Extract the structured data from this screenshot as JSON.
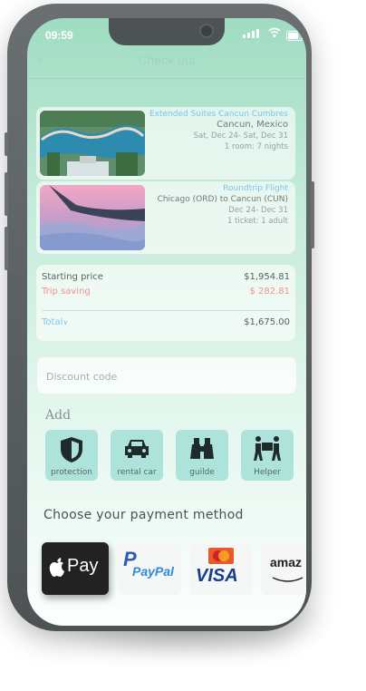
{
  "status": {
    "time": "09:59"
  },
  "header": {
    "title": "Check out",
    "back_icon": "chevron-left-icon"
  },
  "hotel": {
    "name": "Extended Suites Cancun Cumbres",
    "location": "Cancun, Mexico",
    "dates": "Sat, Dec 24- Sat, Dec 31",
    "rooms": "1 room: 7 nights"
  },
  "flight": {
    "name": "Roundtrip Flight",
    "route": "Chicago (ORD) to Cancun (CUN)",
    "dates": "Dec 24-  Dec 31",
    "tickets": "1 ticket: 1 adult"
  },
  "price": {
    "starting_label": "Starting price",
    "starting_value": "$1,954.81",
    "saving_label": "Trip saving",
    "saving_value": "$   282.81",
    "total_label": "Total",
    "total_value": "$1,675.00"
  },
  "discount": {
    "placeholder": "Discount code"
  },
  "add": {
    "heading": "Add",
    "items": [
      {
        "label": "protection",
        "icon": "shield-icon"
      },
      {
        "label": "rental car",
        "icon": "car-icon"
      },
      {
        "label": "guilde",
        "icon": "binoculars-icon"
      },
      {
        "label": "Helper",
        "icon": "people-carry-icon"
      }
    ]
  },
  "payment": {
    "heading": "Choose your payment method",
    "methods": [
      {
        "name": "apple-pay",
        "text": "Pay"
      },
      {
        "name": "paypal",
        "text": "PayPal"
      },
      {
        "name": "visa",
        "text": "VISA"
      },
      {
        "name": "amazon",
        "text": "amaz"
      }
    ]
  },
  "colors": {
    "accent_blue": "#7cc6ea",
    "saving_red": "#f3918f",
    "screen_top": "#9fdcc2",
    "addon_bg": "#aee3dc"
  }
}
